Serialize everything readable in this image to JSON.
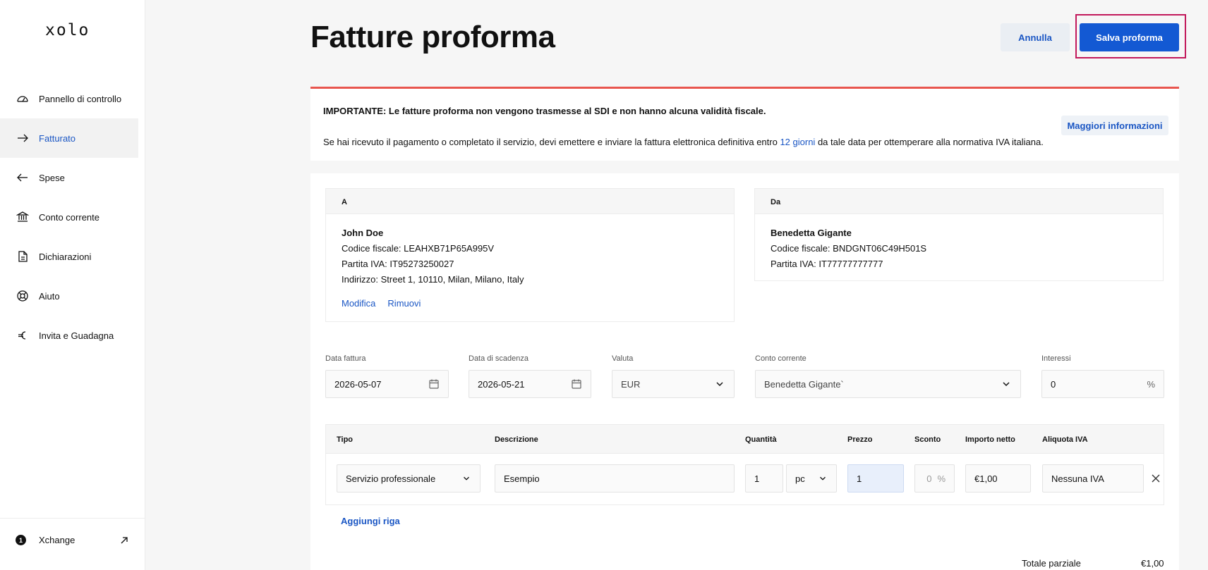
{
  "app": {
    "logo": "xolo"
  },
  "sidebar": {
    "items": [
      {
        "label": "Pannello di controllo",
        "icon": "gauge-icon"
      },
      {
        "label": "Fatturato",
        "icon": "arrow-right-icon",
        "active": true
      },
      {
        "label": "Spese",
        "icon": "arrow-left-icon"
      },
      {
        "label": "Conto corrente",
        "icon": "bank-icon"
      },
      {
        "label": "Dichiarazioni",
        "icon": "document-icon"
      },
      {
        "label": "Aiuto",
        "icon": "lifebuoy-icon"
      },
      {
        "label": "Invita e Guadagna",
        "icon": "euro-icon"
      }
    ],
    "bottom": {
      "badge": "1",
      "label": "Xchange",
      "icon": "external-link-icon"
    }
  },
  "header": {
    "title": "Fatture proforma",
    "cancel_label": "Annulla",
    "save_label": "Salva proforma"
  },
  "notice": {
    "strong": "IMPORTANTE: Le fatture proforma non vengono trasmesse al SDI e non hanno alcuna validità fiscale.",
    "body_before": "Se hai ricevuto il pagamento o completato il servizio, devi emettere e inviare la fattura elettronica definitiva entro ",
    "body_link": "12 giorni",
    "body_after": " da tale data per ottemperare alla normativa IVA italiana.",
    "more_label": "Maggiori informazioni"
  },
  "to": {
    "heading": "A",
    "name": "John Doe",
    "fiscal_code": "Codice fiscale: LEAHXB71P65A995V",
    "vat": "Partita IVA: IT95273250027",
    "address": "Indirizzo: Street 1, 10110, Milan, Milano, Italy",
    "edit_label": "Modifica",
    "remove_label": "Rimuovi"
  },
  "from": {
    "heading": "Da",
    "name": "Benedetta Gigante",
    "fiscal_code": "Codice fiscale: BNDGNT06C49H501S",
    "vat": "Partita IVA: IT77777777777"
  },
  "fields": {
    "invoice_date": {
      "label": "Data fattura",
      "value": "2026-05-07"
    },
    "due_date": {
      "label": "Data di scadenza",
      "value": "2026-05-21"
    },
    "currency": {
      "label": "Valuta",
      "value": "EUR"
    },
    "account": {
      "label": "Conto corrente",
      "value": "Benedetta Gigante`"
    },
    "interest": {
      "label": "Interessi",
      "value": "0",
      "unit": "%"
    }
  },
  "table": {
    "headers": {
      "type": "Tipo",
      "description": "Descrizione",
      "quantity": "Quantità",
      "price": "Prezzo",
      "discount": "Sconto",
      "net": "Importo netto",
      "vat": "Aliquota IVA"
    },
    "row": {
      "type": "Servizio professionale",
      "description": "Esempio",
      "quantity": "1",
      "unit": "pc",
      "price": "1",
      "discount": "0",
      "discount_unit": "%",
      "net": "€1,00",
      "vat": "Nessuna IVA"
    },
    "add_row_label": "Aggiungi riga"
  },
  "totals": {
    "subtotal_label": "Totale parziale",
    "subtotal_value": "€1,00"
  },
  "colors": {
    "accent": "#1359d3",
    "link": "#1a56c4",
    "warning": "#e8554e",
    "focus_outline": "#c2185b"
  }
}
